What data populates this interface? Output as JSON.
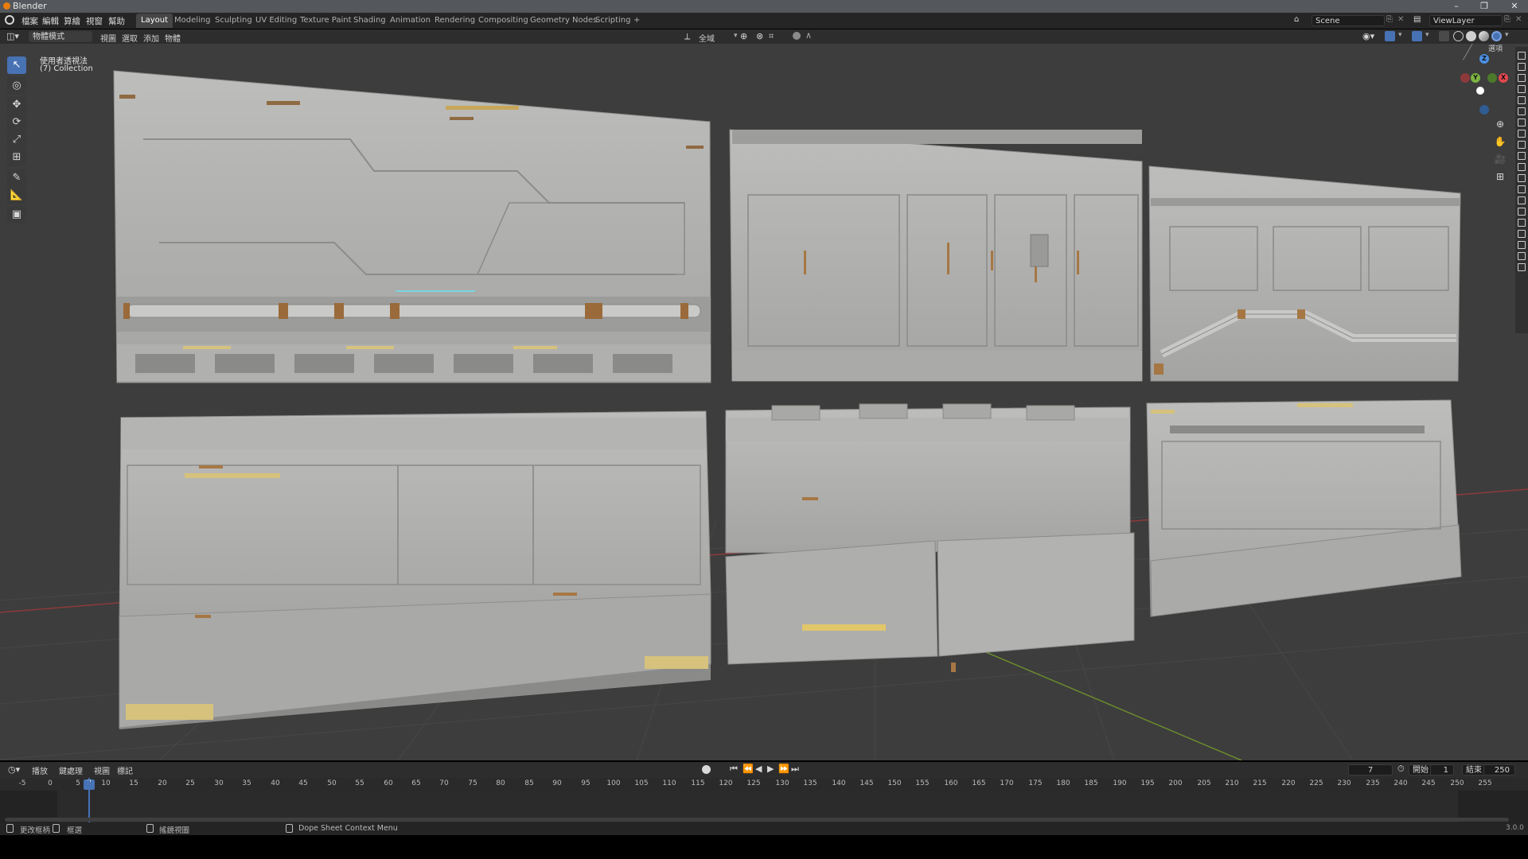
{
  "window": {
    "title": "Blender",
    "minimize": "–",
    "maximize": "❐",
    "close": "✕"
  },
  "menu": {
    "items": [
      "檔案",
      "編輯",
      "算繪",
      "視窗",
      "幫助"
    ],
    "tabs": [
      {
        "label": "Layout",
        "active": true
      },
      {
        "label": "Modeling"
      },
      {
        "label": "Sculpting"
      },
      {
        "label": "UV Editing"
      },
      {
        "label": "Texture Paint"
      },
      {
        "label": "Shading"
      },
      {
        "label": "Animation"
      },
      {
        "label": "Rendering"
      },
      {
        "label": "Compositing"
      },
      {
        "label": "Geometry Nodes"
      },
      {
        "label": "Scripting"
      }
    ],
    "add_tab": "+",
    "scene": "Scene",
    "view_layer": "ViewLayer"
  },
  "header": {
    "mode": "物體模式",
    "menus": [
      "視圖",
      "選取",
      "添加",
      "物體"
    ],
    "orientation": "全域",
    "options": "選項"
  },
  "viewport": {
    "view_name": "使用者透視法",
    "collection": "(7) Collection",
    "gizmo": {
      "z": "Z",
      "y": "Y",
      "x": "X"
    },
    "colors": {
      "x": "#e5484d",
      "y": "#7cb342",
      "z": "#4a90e2"
    }
  },
  "timeline": {
    "menus": [
      "播放",
      "鍵處理",
      "視圖",
      "標記"
    ],
    "current_frame": "7",
    "start_label": "開始",
    "start": "1",
    "end_label": "結束",
    "end": "250",
    "ticks": [
      "-5",
      "0",
      "5",
      "7",
      "10",
      "15",
      "20",
      "25",
      "30",
      "35",
      "40",
      "45",
      "50",
      "55",
      "60",
      "65",
      "70",
      "75",
      "80",
      "85",
      "90",
      "95",
      "100",
      "105",
      "110",
      "115",
      "120",
      "125",
      "130",
      "135",
      "140",
      "145",
      "150",
      "155",
      "160",
      "165",
      "170",
      "175",
      "180",
      "185",
      "190",
      "195",
      "200",
      "205",
      "210",
      "215",
      "220",
      "225",
      "230",
      "235",
      "240",
      "245",
      "250",
      "255"
    ]
  },
  "status": {
    "item1": "更改框柄",
    "item2": "框選",
    "item3": "搖鏡視圖",
    "item4": "Dope Sheet Context Menu",
    "version": "3.0.0"
  }
}
